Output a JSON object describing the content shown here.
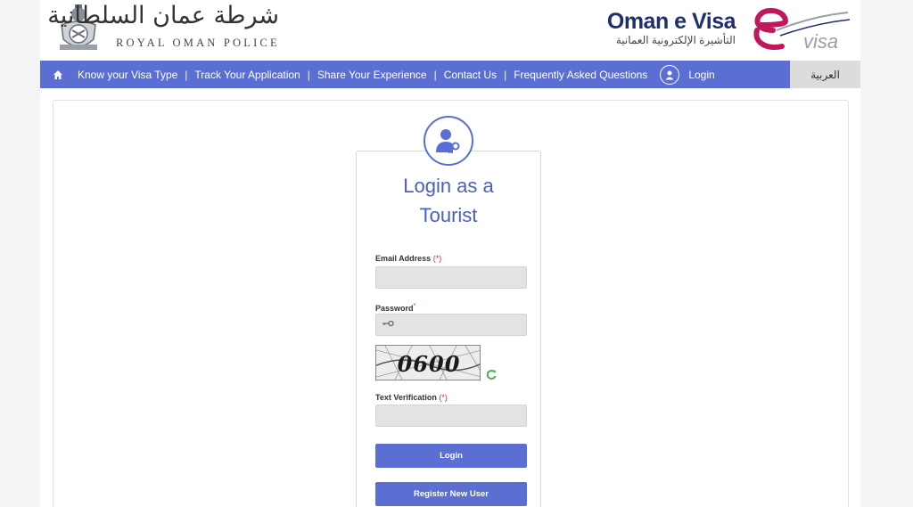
{
  "header": {
    "rop_arabic": "شرطة عمان السلطانية",
    "rop_english": "ROYAL OMAN POLICE",
    "evisa_title": "Oman e Visa",
    "evisa_arabic": "التأشيرة الإلكترونية العمانية"
  },
  "nav": {
    "items": [
      {
        "label": "Know your Visa Type"
      },
      {
        "label": "Track Your Application"
      },
      {
        "label": "Share Your Experience"
      },
      {
        "label": "Contact Us"
      },
      {
        "label": "Frequently Asked Questions"
      }
    ],
    "separator": "|",
    "login_label": "Login",
    "language_label": "العربية"
  },
  "login_card": {
    "title_line1": "Login as a",
    "title_line2": "Tourist",
    "email_label": "Email Address",
    "email_required_mark": "(*)",
    "email_value": "",
    "password_label": "Password",
    "password_required_mark": "*",
    "password_value": "",
    "captcha_text": "0600",
    "verification_label": "Text Verification",
    "verification_required_mark": "(*)",
    "verification_value": "",
    "login_button": "Login",
    "register_button": "Register New User"
  },
  "colors": {
    "accent": "#5b6fd2",
    "title_text": "#4a5fc1",
    "brand_navy": "#1f2e6e",
    "brand_magenta": "#c2185b",
    "required": "#d32f2f"
  },
  "icons": {
    "home": "home-icon",
    "user": "user-circle-icon",
    "login_card": "user-key-icon",
    "password": "key-icon",
    "refresh": "refresh-icon",
    "rop_emblem": "royal-oman-police-emblem",
    "evisa_logo": "evisa-logo"
  }
}
